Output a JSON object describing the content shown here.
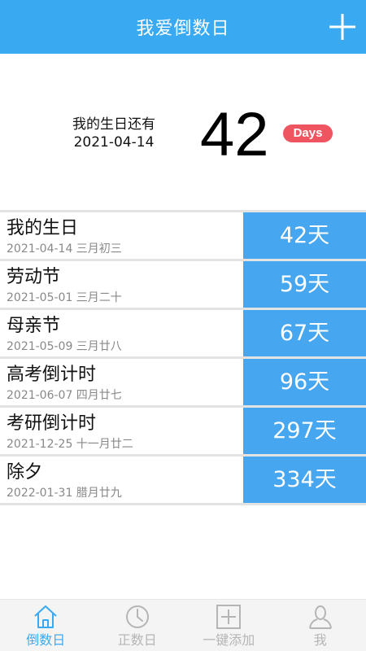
{
  "header": {
    "title": "我爱倒数日",
    "add_icon": "plus-icon"
  },
  "hero": {
    "line1": "我的生日还有",
    "line2": "2021-04-14",
    "days": "42",
    "badge": "Days"
  },
  "events": [
    {
      "name": "我的生日",
      "date": "2021-04-14  三月初三",
      "count": "42天"
    },
    {
      "name": "劳动节",
      "date": "2021-05-01  三月二十",
      "count": "59天"
    },
    {
      "name": "母亲节",
      "date": "2021-05-09  三月廿八",
      "count": "67天"
    },
    {
      "name": "高考倒计时",
      "date": "2021-06-07  四月廿七",
      "count": "96天"
    },
    {
      "name": "考研倒计时",
      "date": "2021-12-25  十一月廿二",
      "count": "297天"
    },
    {
      "name": "除夕",
      "date": "2022-01-31  腊月廿九",
      "count": "334天"
    }
  ],
  "tabs": [
    {
      "label": "倒数日",
      "icon": "home-icon"
    },
    {
      "label": "正数日",
      "icon": "clock-icon"
    },
    {
      "label": "一键添加",
      "icon": "add-box-icon"
    },
    {
      "label": "我",
      "icon": "person-icon"
    }
  ],
  "colors": {
    "header": "#39aaf1",
    "count_bg": "#46a6f0",
    "badge": "#ef5560",
    "tab_active": "#39aaf1",
    "tab_inactive": "#b5b5b5"
  }
}
